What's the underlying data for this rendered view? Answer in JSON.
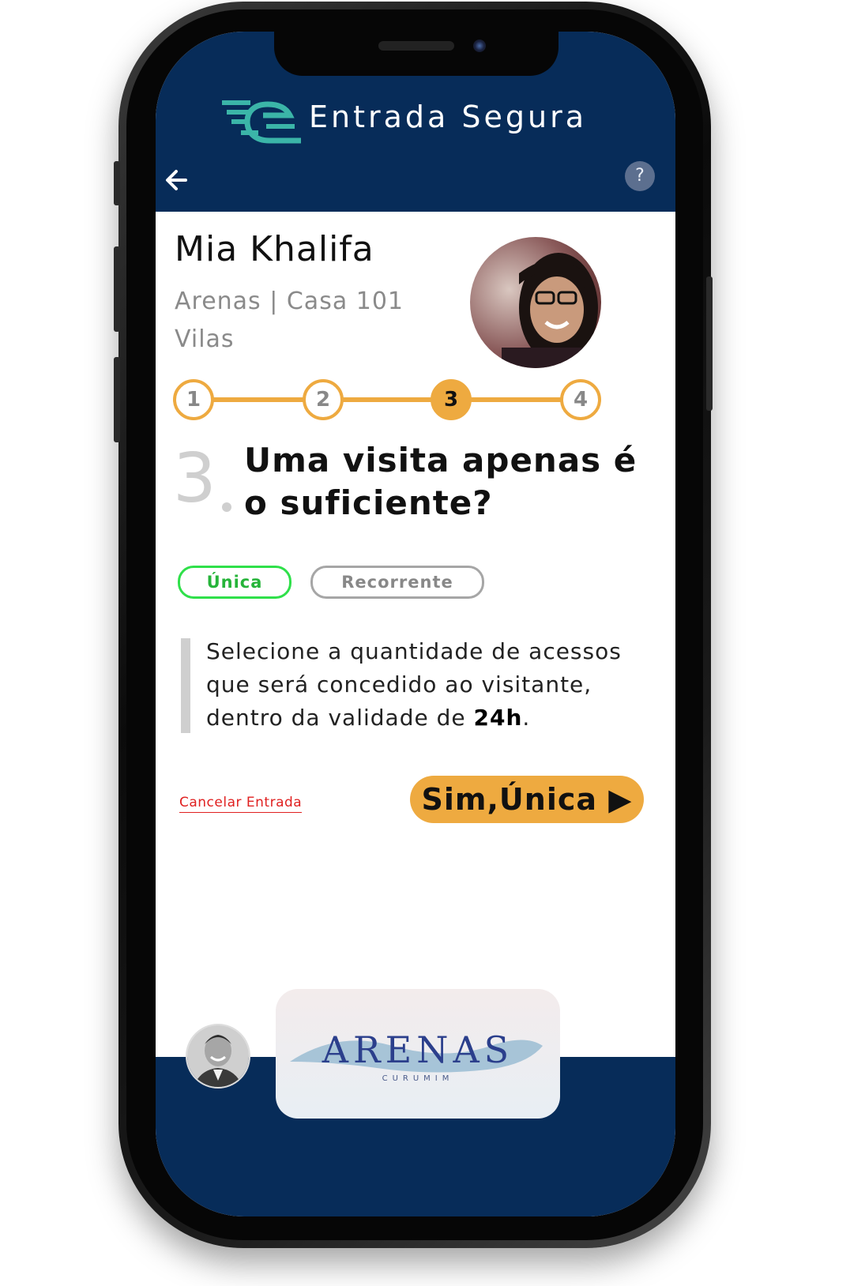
{
  "app": {
    "title": "Entrada Segura",
    "help_symbol": "?"
  },
  "visitor": {
    "name": "Mia Khalifa",
    "location": "Arenas | Casa 101",
    "area": "Vilas"
  },
  "stepper": {
    "steps": [
      "1",
      "2",
      "3",
      "4"
    ],
    "current": 3
  },
  "question": {
    "number": "3",
    "text": "Uma visita apenas é o suficiente?"
  },
  "options": {
    "single": "Única",
    "recurring": "Recorrente",
    "selected": "Única"
  },
  "note": {
    "text": "Selecione a quantidade de acessos que será concedido ao visitante, dentro da validade de ",
    "highlight": "24h",
    "suffix": "."
  },
  "actions": {
    "cancel": "Cancelar Entrada",
    "confirm": "Sim,Única ▶"
  },
  "footer": {
    "brand_word": "ARENAS",
    "brand_sub": "CURUMIM"
  },
  "colors": {
    "header": "#072c59",
    "accent": "#eeaa40",
    "selected": "#2fe04a",
    "cancel": "#e02020"
  },
  "icons": [
    "back-arrow-icon",
    "help-icon",
    "entrada-segura-logo"
  ]
}
